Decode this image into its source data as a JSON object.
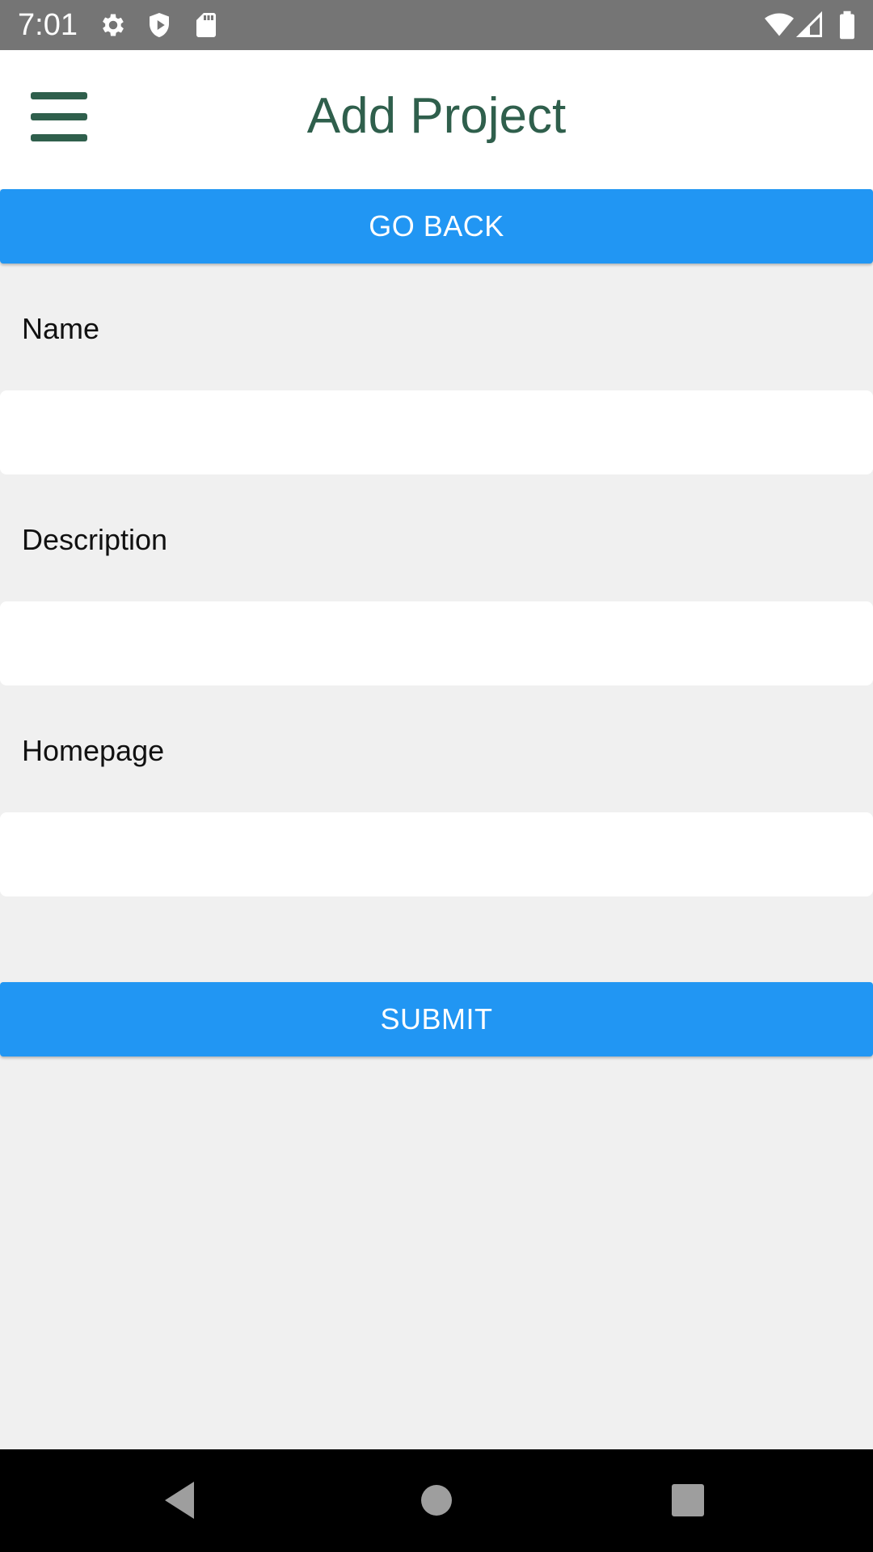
{
  "status_bar": {
    "time": "7:01",
    "left_icons": [
      "gear-icon",
      "shield-icon",
      "sd-card-icon"
    ],
    "right_icons": [
      "wifi-icon",
      "cell-signal-icon",
      "battery-icon"
    ]
  },
  "app_bar": {
    "title": "Add Project",
    "menu_icon": "hamburger-menu-icon",
    "title_color": "#2f5f4c"
  },
  "actions": {
    "go_back_label": "GO BACK",
    "submit_label": "SUBMIT",
    "button_color": "#2196f3"
  },
  "form": {
    "fields": [
      {
        "label": "Name",
        "value": "",
        "placeholder": ""
      },
      {
        "label": "Description",
        "value": "",
        "placeholder": ""
      },
      {
        "label": "Homepage",
        "value": "",
        "placeholder": ""
      }
    ]
  },
  "nav_bar": {
    "buttons": [
      "back-triangle-icon",
      "home-circle-icon",
      "recents-square-icon"
    ]
  }
}
